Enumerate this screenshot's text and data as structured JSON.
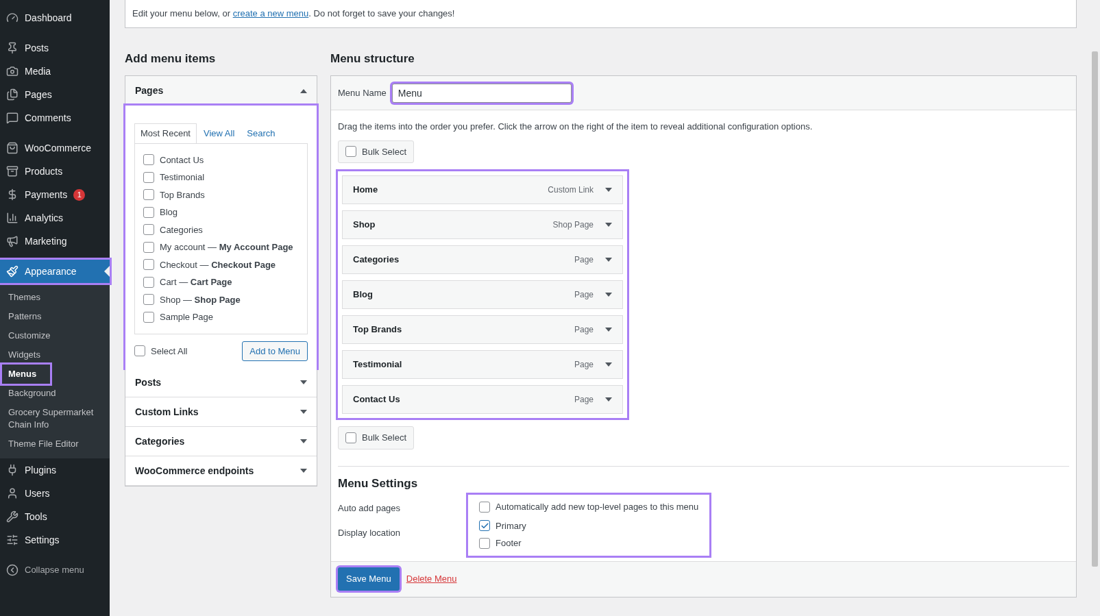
{
  "sidebar": {
    "groups": [
      {
        "items": [
          {
            "label": "Dashboard",
            "selected": false
          }
        ]
      },
      {
        "items": [
          {
            "label": "Posts",
            "selected": false
          },
          {
            "label": "Media",
            "selected": false
          },
          {
            "label": "Pages",
            "selected": false
          },
          {
            "label": "Comments",
            "selected": false
          }
        ]
      },
      {
        "items": [
          {
            "label": "WooCommerce",
            "selected": false
          },
          {
            "label": "Products",
            "selected": false
          },
          {
            "label": "Payments",
            "selected": false,
            "badge": "1"
          },
          {
            "label": "Analytics",
            "selected": false
          },
          {
            "label": "Marketing",
            "selected": false
          }
        ]
      },
      {
        "items": [
          {
            "label": "Appearance",
            "selected": true,
            "highlighted": true,
            "children": [
              {
                "label": "Themes",
                "selected": false
              },
              {
                "label": "Patterns",
                "selected": false
              },
              {
                "label": "Customize",
                "selected": false
              },
              {
                "label": "Widgets",
                "selected": false
              },
              {
                "label": "Menus",
                "selected": true,
                "highlighted": true
              },
              {
                "label": "Background",
                "selected": false
              },
              {
                "label": "Grocery Supermarket Chain Info",
                "selected": false
              },
              {
                "label": "Theme File Editor",
                "selected": false
              }
            ]
          },
          {
            "label": "Plugins",
            "selected": false
          },
          {
            "label": "Users",
            "selected": false
          },
          {
            "label": "Tools",
            "selected": false
          },
          {
            "label": "Settings",
            "selected": false
          }
        ]
      }
    ],
    "collapse": "Collapse menu"
  },
  "notice": {
    "before": "Edit your menu below, or ",
    "link": "create a new menu",
    "after": ". Do not forget to save your changes!"
  },
  "add_items": {
    "title": "Add menu items",
    "sections": [
      {
        "title": "Pages",
        "expanded": true,
        "highlighted": true,
        "tabs": [
          {
            "label": "Most Recent",
            "selected": true
          },
          {
            "label": "View All",
            "selected": false
          },
          {
            "label": "Search",
            "selected": false
          }
        ],
        "items": [
          {
            "label": "Contact Us",
            "checked": false
          },
          {
            "label": "Testimonial",
            "checked": false
          },
          {
            "label": "Top Brands",
            "checked": false
          },
          {
            "label": "Blog",
            "checked": false
          },
          {
            "label": "Categories",
            "checked": false
          },
          {
            "label": "My account — **My Account Page**",
            "checked": false
          },
          {
            "label": "Checkout — **Checkout Page**",
            "checked": false
          },
          {
            "label": "Cart — **Cart Page**",
            "checked": false
          },
          {
            "label": "Shop — **Shop Page**",
            "checked": false
          },
          {
            "label": "Sample Page",
            "checked": false
          }
        ],
        "select_all": {
          "label": "Select All",
          "checked": false
        },
        "button": "Add to Menu"
      },
      {
        "title": "Posts",
        "expanded": false
      },
      {
        "title": "Custom Links",
        "expanded": false
      },
      {
        "title": "Categories",
        "expanded": false
      },
      {
        "title": "WooCommerce endpoints",
        "expanded": false
      }
    ]
  },
  "structure": {
    "title": "Menu structure",
    "menu_name": {
      "label": "Menu Name",
      "value": "Menu",
      "highlighted": true
    },
    "instructions": "Drag the items into the order you prefer. Click the arrow on the right of the item to reveal additional configuration options.",
    "bulk_select_top": {
      "label": "Bulk Select",
      "checked": false
    },
    "menu_items": {
      "highlighted": true,
      "items": [
        {
          "title": "Home",
          "type": "Custom Link"
        },
        {
          "title": "Shop",
          "type": "Shop Page"
        },
        {
          "title": "Categories",
          "type": "Page"
        },
        {
          "title": "Blog",
          "type": "Page"
        },
        {
          "title": "Top Brands",
          "type": "Page"
        },
        {
          "title": "Testimonial",
          "type": "Page"
        },
        {
          "title": "Contact Us",
          "type": "Page"
        }
      ]
    },
    "bulk_select_bottom": {
      "label": "Bulk Select",
      "checked": false
    },
    "settings": {
      "title": "Menu Settings",
      "highlighted": true,
      "rows": [
        {
          "label": "Auto add pages",
          "options": [
            {
              "label": "Automatically add new top-level pages to this menu",
              "checked": false
            }
          ]
        },
        {
          "label": "Display location",
          "options": [
            {
              "label": "Primary",
              "checked": true
            },
            {
              "label": "Footer",
              "checked": false
            }
          ]
        }
      ]
    },
    "save": {
      "label": "Save Menu",
      "highlighted": true
    },
    "delete": "Delete Menu"
  }
}
